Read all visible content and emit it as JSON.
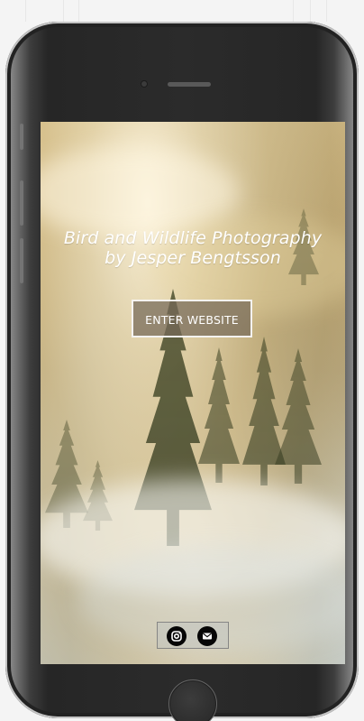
{
  "hero": {
    "title_line1": "Bird and Wildlife Photography",
    "title_line2": "by Jesper Bengtsson",
    "button_label": "ENTER WEBSITE"
  },
  "social": {
    "instagram_icon": "instagram-icon",
    "mail_icon": "mail-icon"
  },
  "colors": {
    "phone_body": "#2b2b2b",
    "button_overlay": "#746858",
    "text": "#ffffff",
    "social_background": "#bcc1c0"
  }
}
